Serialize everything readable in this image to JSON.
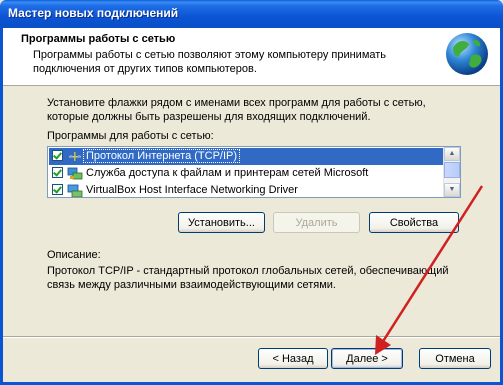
{
  "window": {
    "title": "Мастер новых подключений"
  },
  "header": {
    "title": "Программы работы с сетью",
    "subtitle": "Программы работы с сетью позволяют этому компьютеру принимать подключения от других типов компьютеров."
  },
  "instructions": "Установите флажки рядом с именами всех программ для работы с сетью, которые должны быть разрешены для входящих подключений.",
  "list": {
    "label": "Программы для работы с сетью:",
    "items": [
      {
        "label": "Протокол Интернета (TCP/IP)",
        "checked": true,
        "selected": true,
        "icon": "network-protocol-icon"
      },
      {
        "label": "Служба доступа к файлам и принтерам сетей Microsoft",
        "checked": true,
        "selected": false,
        "icon": "file-printer-sharing-icon"
      },
      {
        "label": "VirtualBox Host Interface Networking Driver",
        "checked": true,
        "selected": false,
        "icon": "network-driver-icon"
      }
    ]
  },
  "actions": {
    "install": "Установить...",
    "remove": "Удалить",
    "properties": "Свойства"
  },
  "description": {
    "title": "Описание:",
    "text": "Протокол TCP/IP - стандартный протокол глобальных сетей, обеспечивающий связь между различными взаимодействующими сетями."
  },
  "footer": {
    "back": "< Назад",
    "next": "Далее >",
    "cancel": "Отмена"
  },
  "colors": {
    "titlebar": "#0b54d4",
    "selection": "#316ac5",
    "dialog": "#ece9d8",
    "annotation_arrow": "#d02020"
  }
}
